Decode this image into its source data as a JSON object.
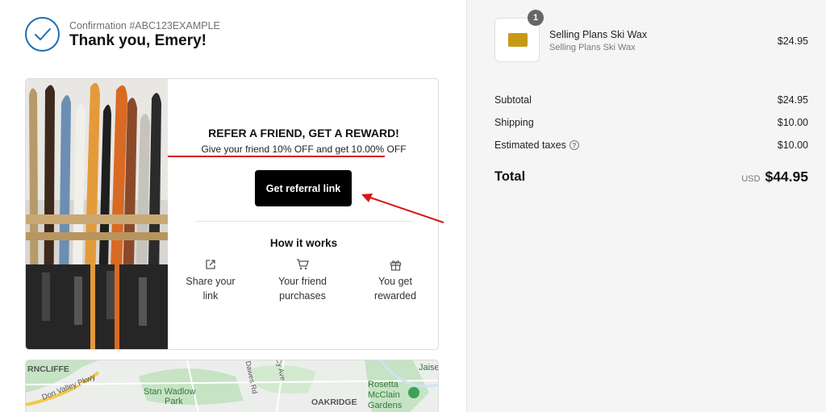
{
  "header": {
    "confirmation": "Confirmation #ABC123EXAMPLE",
    "thanks": "Thank you, Emery!"
  },
  "referral": {
    "title": "REFER A FRIEND, GET A REWARD!",
    "subtitle": "Give your friend 10% OFF and get 10.00% OFF",
    "button_label": "Get referral link",
    "how_title": "How it works",
    "steps": [
      {
        "icon": "external-link-icon",
        "line1": "Share your",
        "line2": "link"
      },
      {
        "icon": "cart-icon",
        "line1": "Your friend",
        "line2": "purchases"
      },
      {
        "icon": "gift-icon",
        "line1": "You get",
        "line2": "rewarded"
      }
    ]
  },
  "map": {
    "labels": [
      "RNCLIFFE",
      "Don Valley Pkwy",
      "Stan Wadlow",
      "Park",
      "Dawes Rd",
      "Cy Ave",
      "OAKRIDGE",
      "Rosetta",
      "McClain",
      "Gardens",
      "Jaise"
    ]
  },
  "order": {
    "item": {
      "quantity": "1",
      "name": "Selling Plans Ski Wax",
      "variant": "Selling Plans Ski Wax",
      "price": "$24.95"
    },
    "subtotal_label": "Subtotal",
    "subtotal": "$24.95",
    "shipping_label": "Shipping",
    "shipping": "$10.00",
    "taxes_label": "Estimated taxes",
    "taxes": "$10.00",
    "total_label": "Total",
    "currency": "USD",
    "total": "$44.95"
  },
  "colors": {
    "accent": "#1e6fb3",
    "annotation": "#d41818",
    "button": "#000000",
    "summary_bg": "#f5f5f5"
  }
}
